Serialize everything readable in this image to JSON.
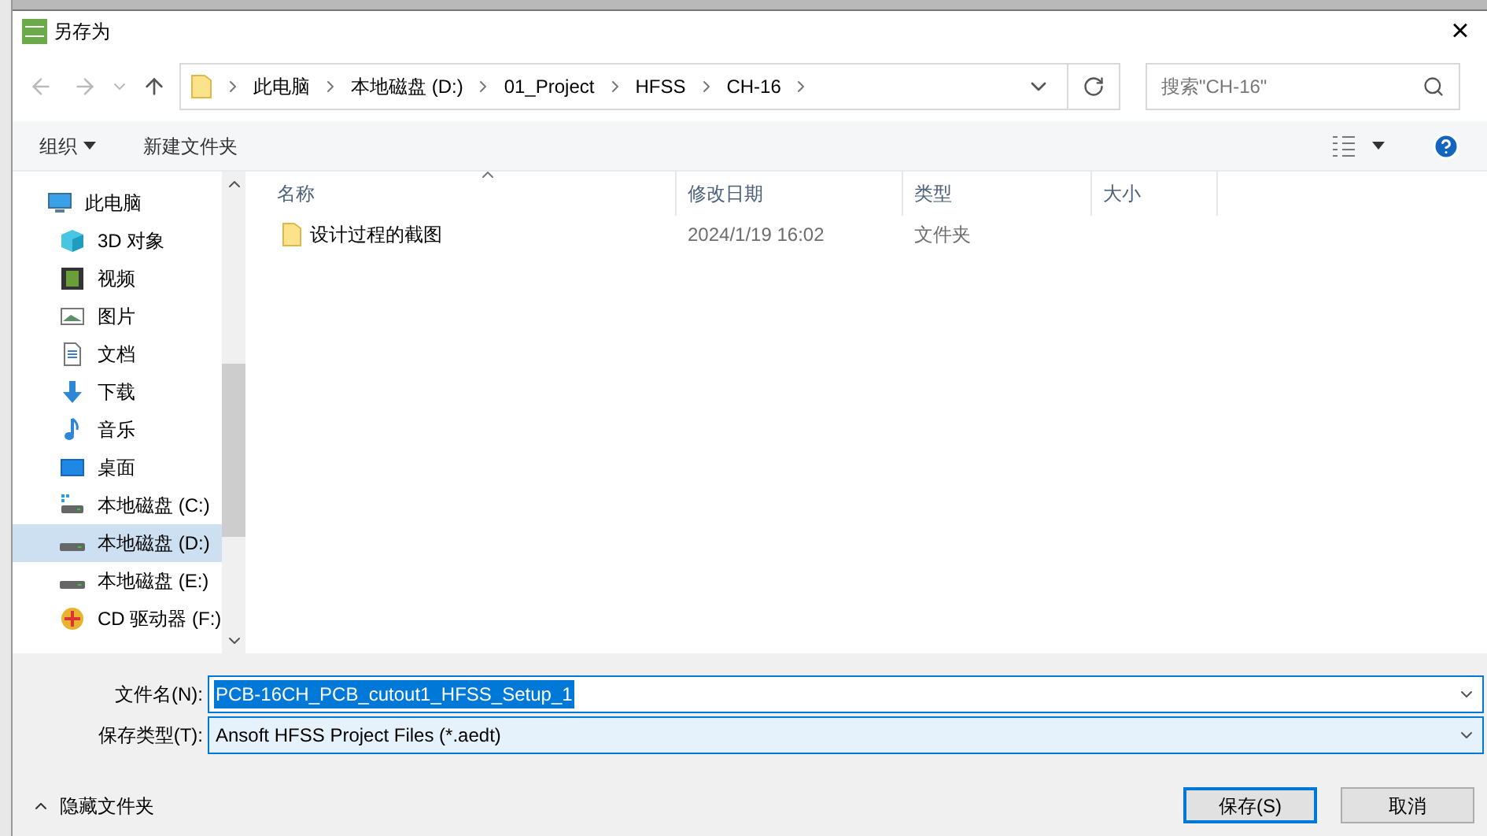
{
  "window": {
    "title": "另存为",
    "close": "×"
  },
  "address": {
    "path": [
      "此电脑",
      "本地磁盘 (D:)",
      "01_Project",
      "HFSS",
      "CH-16"
    ]
  },
  "search": {
    "placeholder": "搜索\"CH-16\""
  },
  "toolbar": {
    "organize": "组织",
    "new_folder": "新建文件夹"
  },
  "sidebar": {
    "items": [
      {
        "label": "此电脑",
        "kind": "pc",
        "selected": false,
        "children": [
          {
            "label": "3D 对象",
            "kind": "cube",
            "selected": false
          },
          {
            "label": "视频",
            "kind": "video",
            "selected": false
          },
          {
            "label": "图片",
            "kind": "picture",
            "selected": false
          },
          {
            "label": "文档",
            "kind": "document",
            "selected": false
          },
          {
            "label": "下载",
            "kind": "download",
            "selected": false
          },
          {
            "label": "音乐",
            "kind": "music",
            "selected": false
          },
          {
            "label": "桌面",
            "kind": "desktop",
            "selected": false
          },
          {
            "label": "本地磁盘 (C:)",
            "kind": "system-drive",
            "selected": false
          },
          {
            "label": "本地磁盘 (D:)",
            "kind": "drive",
            "selected": true
          },
          {
            "label": "本地磁盘 (E:)",
            "kind": "drive",
            "selected": false
          },
          {
            "label": "CD 驱动器 (F:)",
            "kind": "cd",
            "selected": false
          }
        ]
      }
    ]
  },
  "table": {
    "columns": [
      "名称",
      "修改日期",
      "类型",
      "大小"
    ],
    "rows": [
      {
        "name": "设计过程的截图",
        "modified": "2024/1/19 16:02",
        "type": "文件夹",
        "size": ""
      }
    ]
  },
  "form": {
    "file_name_label": "文件名(N):",
    "file_name": "PCB-16CH_PCB_cutout1_HFSS_Setup_1",
    "file_type_label": "保存类型(T):",
    "file_type": "Ansoft HFSS Project Files (*.aedt)"
  },
  "footer": {
    "hide_folders": "隐藏文件夹",
    "buttons": [
      "保存(S)",
      "取消"
    ]
  }
}
